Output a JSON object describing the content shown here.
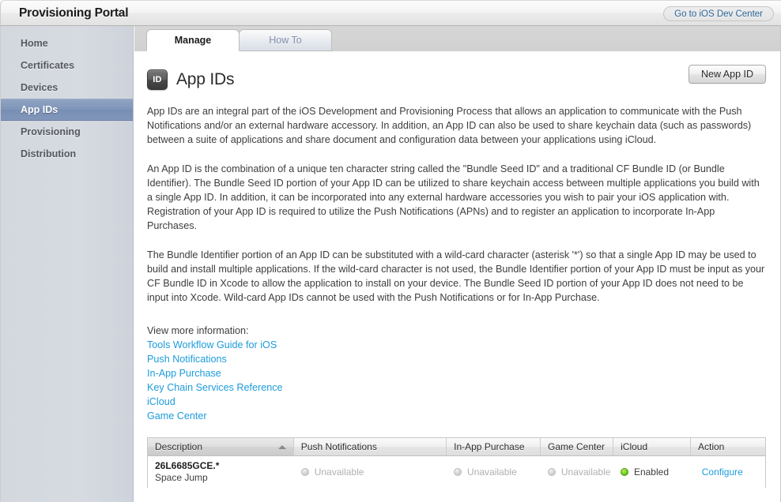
{
  "titlebar": {
    "app_title": "Provisioning Portal",
    "dev_center_button": "Go to iOS Dev Center"
  },
  "sidebar": {
    "items": [
      {
        "label": "Home",
        "selected": false
      },
      {
        "label": "Certificates",
        "selected": false
      },
      {
        "label": "Devices",
        "selected": false
      },
      {
        "label": "App IDs",
        "selected": true
      },
      {
        "label": "Provisioning",
        "selected": false
      },
      {
        "label": "Distribution",
        "selected": false
      }
    ]
  },
  "tabs": [
    {
      "label": "Manage",
      "active": true
    },
    {
      "label": "How To",
      "active": false
    }
  ],
  "page": {
    "icon_text": "ID",
    "title": "App IDs",
    "new_button": "New App ID",
    "paragraphs": [
      "App IDs are an integral part of the iOS Development and Provisioning Process that allows an application to communicate with the Push Notifications and/or an external hardware accessory. In addition, an App ID can also be used to share keychain data (such as passwords) between a suite of applications and share document and configuration data between your applications using iCloud.",
      "An App ID is the combination of a unique ten character string called the \"Bundle Seed ID\" and a traditional CF Bundle ID (or Bundle Identifier). The Bundle Seed ID portion of your App ID can be utilized to share keychain access between multiple applications you build with a single App ID. In addition, it can be incorporated into any external hardware accessories you wish to pair your iOS application with. Registration of your App ID is required to utilize the Push Notifications (APNs) and to register an application to incorporate In-App Purchases.",
      "The Bundle Identifier portion of an App ID can be substituted with a wild-card character (asterisk '*') so that a single App ID may be used to build and install multiple applications. If the wild-card character is not used, the Bundle Identifier portion of your App ID must be input as your CF Bundle ID in Xcode to allow the application to install on your device. The Bundle Seed ID portion of your App ID does not need to be input into Xcode. Wild-card App IDs cannot be used with the Push Notifications or for In-App Purchase."
    ],
    "links_label": "View more information:",
    "links": [
      "Tools Workflow Guide for iOS",
      "Push Notifications",
      "In-App Purchase",
      "Key Chain Services Reference",
      "iCloud",
      "Game Center"
    ]
  },
  "table": {
    "columns": [
      {
        "label": "Description",
        "sorted": true,
        "sort_direction": "asc"
      },
      {
        "label": "Push Notifications",
        "sorted": false
      },
      {
        "label": "In-App Purchase",
        "sorted": false
      },
      {
        "label": "Game Center",
        "sorted": false
      },
      {
        "label": "iCloud",
        "sorted": false
      },
      {
        "label": "Action",
        "sorted": false
      }
    ],
    "rows": [
      {
        "description_id": "26L6685GCE.*",
        "description_name": "Space Jump",
        "push_notifications": {
          "state": "off",
          "label": "Unavailable"
        },
        "in_app_purchase": {
          "state": "off",
          "label": "Unavailable"
        },
        "game_center": {
          "state": "off",
          "label": "Unavailable"
        },
        "icloud": {
          "state": "on",
          "label": "Enabled"
        },
        "action": "Configure"
      }
    ]
  },
  "colors": {
    "link": "#1d9cdb",
    "enabled_dot": "#7fd52a",
    "disabled_dot": "#d8d8d8",
    "sidebar_selected": "#7f95b9"
  }
}
